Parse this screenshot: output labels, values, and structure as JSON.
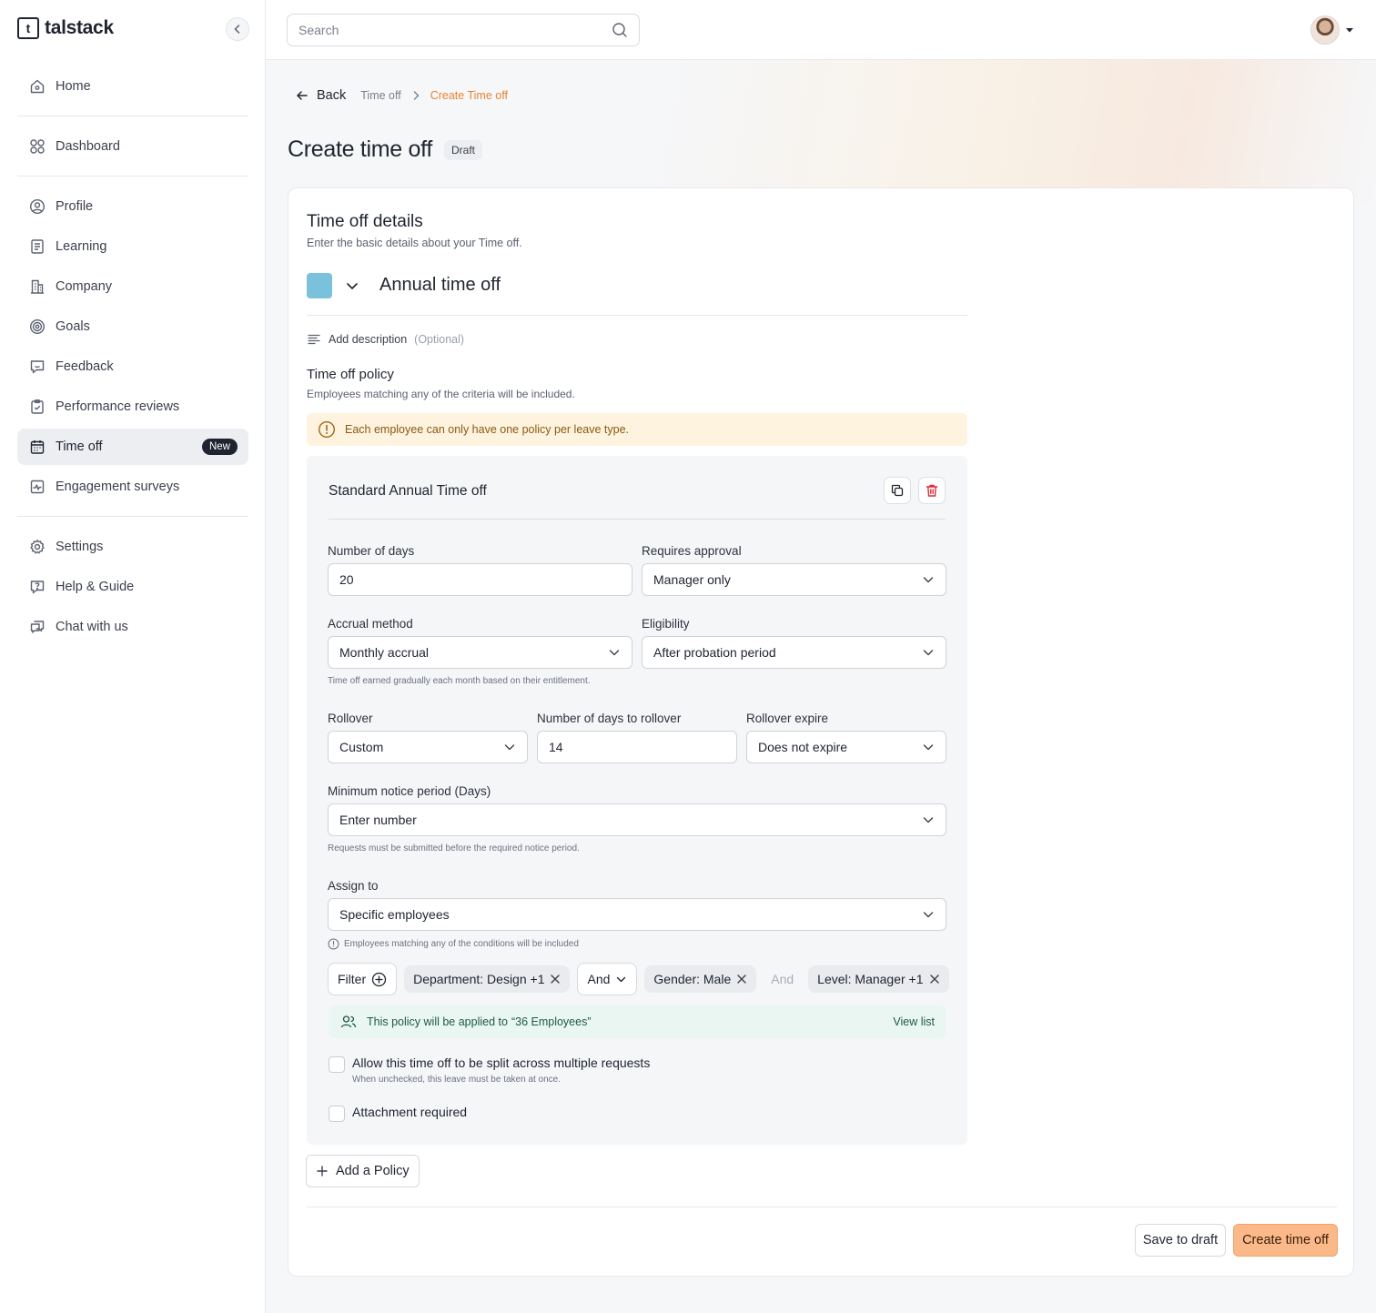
{
  "brand": {
    "name": "talstack",
    "mark": "t"
  },
  "sidebar": {
    "groups": [
      [
        {
          "label": "Home",
          "icon": "home-icon"
        }
      ],
      [
        {
          "label": "Dashboard",
          "icon": "grid-icon"
        }
      ],
      [
        {
          "label": "Profile",
          "icon": "user-circle-icon"
        },
        {
          "label": "Learning",
          "icon": "book-icon"
        },
        {
          "label": "Company",
          "icon": "building-icon"
        },
        {
          "label": "Goals",
          "icon": "target-icon"
        },
        {
          "label": "Feedback",
          "icon": "message-icon"
        },
        {
          "label": "Performance reviews",
          "icon": "clipboard-icon"
        },
        {
          "label": "Time off",
          "icon": "calendar-icon",
          "badge": "New",
          "active": true
        },
        {
          "label": "Engagement surveys",
          "icon": "pulse-icon"
        }
      ],
      [
        {
          "label": "Settings",
          "icon": "gear-icon"
        },
        {
          "label": "Help & Guide",
          "icon": "help-icon"
        },
        {
          "label": "Chat with us",
          "icon": "chat-icon"
        }
      ]
    ]
  },
  "search": {
    "placeholder": "Search"
  },
  "breadcrumb": {
    "back": "Back",
    "parent": "Time off",
    "current": "Create Time off"
  },
  "page": {
    "title": "Create time off",
    "status": "Draft"
  },
  "details": {
    "heading": "Time off details",
    "subheading": "Enter the basic details about your Time off.",
    "type_name": "Annual time off",
    "type_color": "#7ac2dc",
    "add_description": "Add description",
    "optional": "(Optional)"
  },
  "policy": {
    "heading": "Time off policy",
    "subheading": "Employees matching any of the criteria will be included.",
    "warning": "Each employee can only have one policy per leave type.",
    "name": "Standard Annual Time off",
    "fields": {
      "days_label": "Number of days",
      "days_value": "20",
      "approval_label": "Requires approval",
      "approval_value": "Manager only",
      "accrual_label": "Accrual method",
      "accrual_value": "Monthly accrual",
      "accrual_help": "Time off earned gradually each month based on their entitlement.",
      "eligibility_label": "Eligibility",
      "eligibility_value": "After probation period",
      "rollover_label": "Rollover",
      "rollover_value": "Custom",
      "rollover_days_label": "Number of days to rollover",
      "rollover_days_value": "14",
      "rollover_expire_label": "Rollover expire",
      "rollover_expire_value": "Does not expire",
      "notice_label": "Minimum notice period (Days)",
      "notice_placeholder": "Enter number",
      "notice_help": "Requests must be submitted before the required notice period.",
      "assign_label": "Assign to",
      "assign_value": "Specific employees",
      "assign_help": "Employees matching any of the conditions will be included"
    },
    "filters": {
      "filter_label": "Filter",
      "chip1": "Department: Design +1",
      "operator1": "And",
      "chip2": "Gender: Male",
      "operator2": "And",
      "chip3": "Level: Manager +1"
    },
    "applied": {
      "text": "This policy will be applied to",
      "count": "“36 Employees”",
      "view": "View list"
    },
    "split_label": "Allow this time off to be split across multiple requests",
    "split_help": "When unchecked, this leave must be taken at once.",
    "attachment_label": "Attachment required"
  },
  "actions": {
    "add_policy": "Add a Policy",
    "save_draft": "Save to draft",
    "create": "Create time off"
  },
  "colors": {
    "accent": "#e8832f",
    "primary_button": "#fbb989",
    "danger": "#d92d3a"
  }
}
